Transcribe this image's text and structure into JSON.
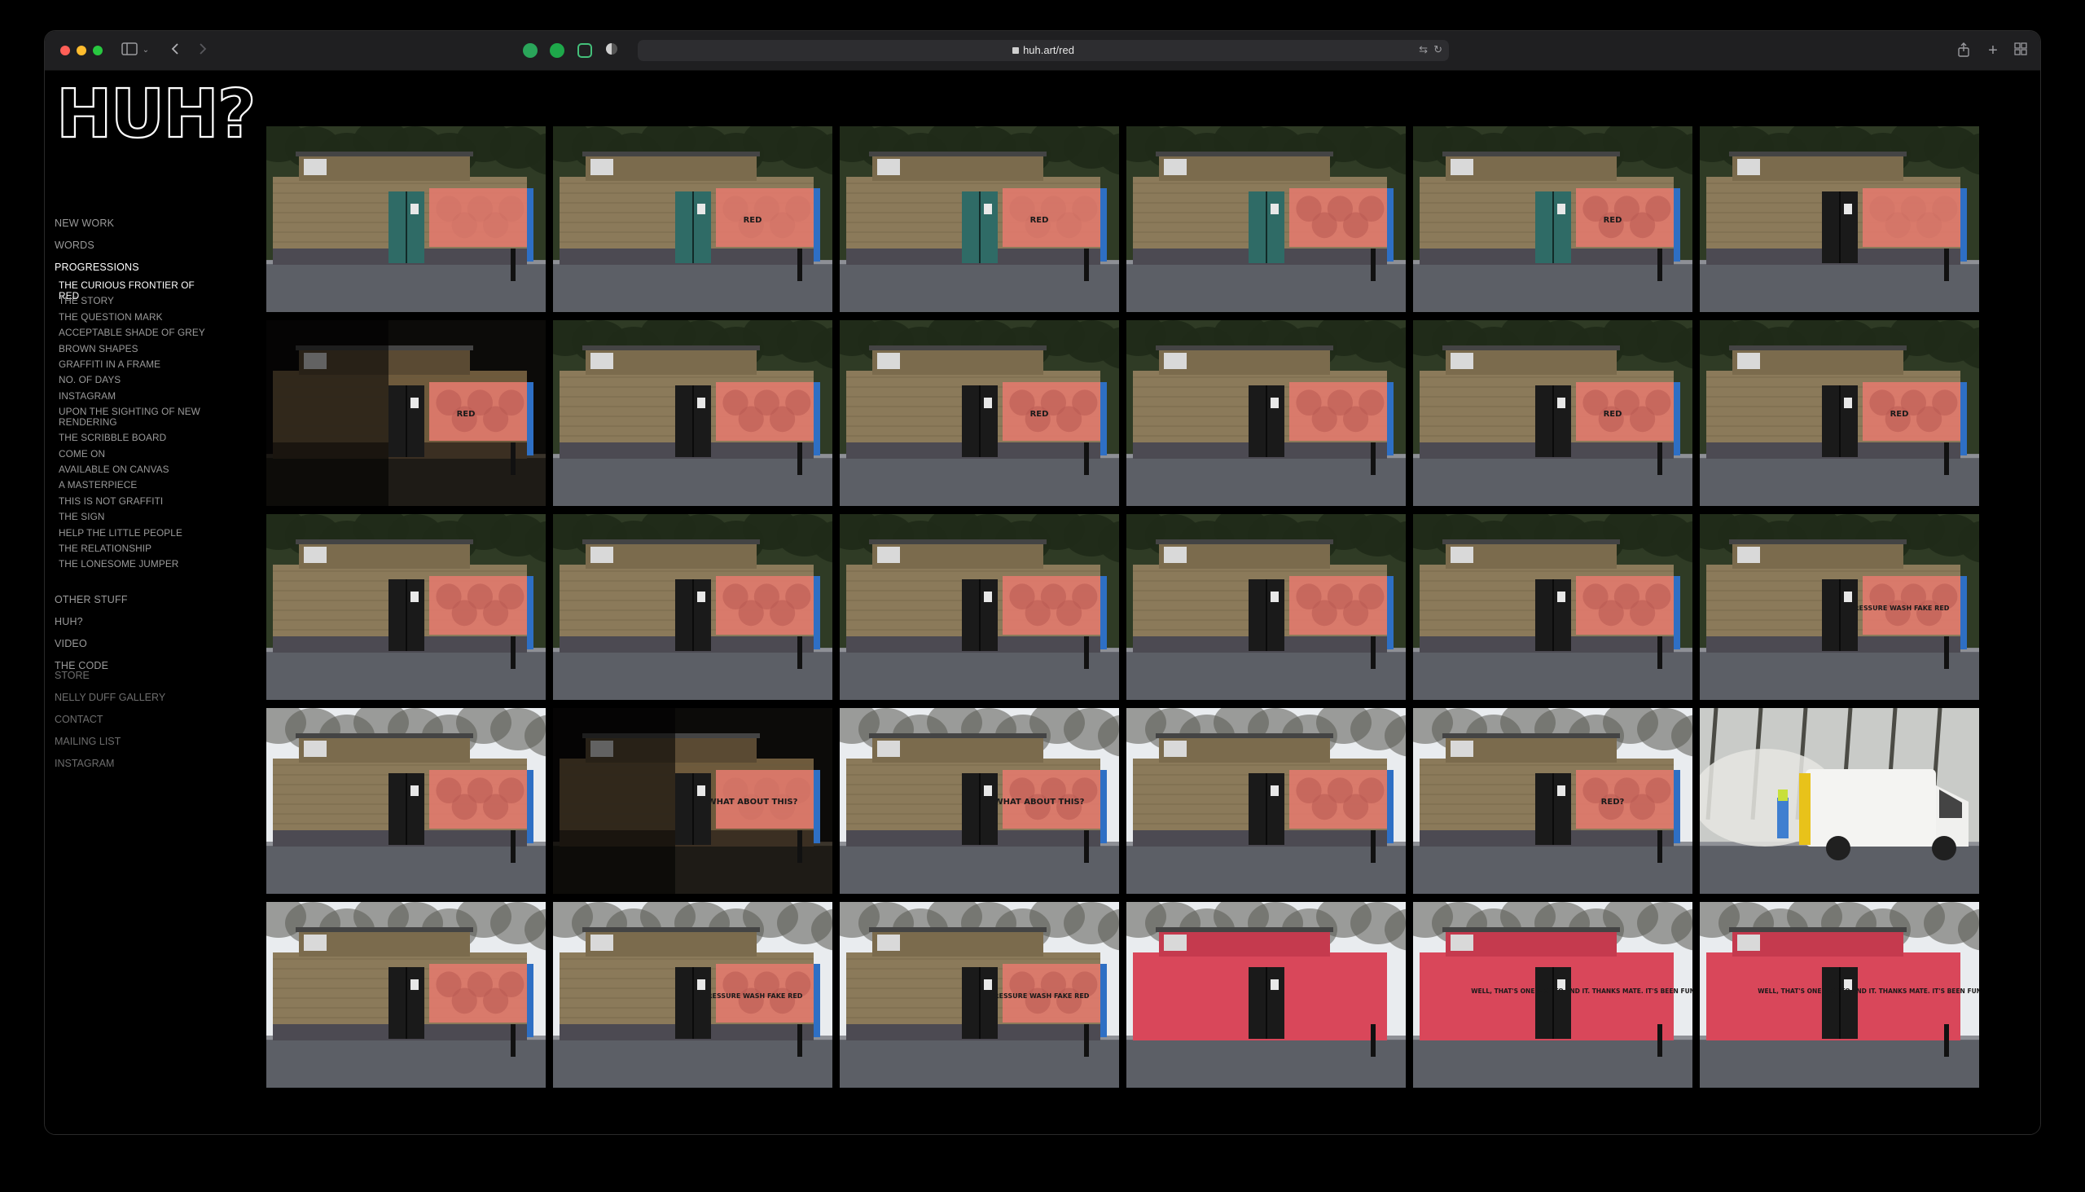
{
  "browser": {
    "url": "huh.art/red"
  },
  "site": {
    "logo_text": "HUH?",
    "nav": {
      "main_top": [
        {
          "label": "NEW WORK",
          "active": false
        },
        {
          "label": "WORDS",
          "active": false
        },
        {
          "label": "PROGRESSIONS",
          "active": true
        }
      ],
      "sub": [
        {
          "label": "THE CURIOUS FRONTIER OF RED",
          "active": true
        },
        {
          "label": "THE STORY",
          "active": false
        },
        {
          "label": "THE QUESTION MARK",
          "active": false
        },
        {
          "label": "ACCEPTABLE SHADE OF GREY",
          "active": false
        },
        {
          "label": "BROWN SHAPES",
          "active": false
        },
        {
          "label": "GRAFFITI IN A FRAME",
          "active": false
        },
        {
          "label": "NO. OF DAYS",
          "active": false
        },
        {
          "label": "INSTAGRAM",
          "active": false
        },
        {
          "label": "UPON THE SIGHTING OF NEW RENDERING",
          "active": false
        },
        {
          "label": "THE SCRIBBLE BOARD",
          "active": false
        },
        {
          "label": "COME ON",
          "active": false
        },
        {
          "label": "AVAILABLE ON CANVAS",
          "active": false
        },
        {
          "label": "A MASTERPIECE",
          "active": false
        },
        {
          "label": "THIS IS NOT GRAFFITI",
          "active": false
        },
        {
          "label": "THE SIGN",
          "active": false
        },
        {
          "label": "HELP THE LITTLE PEOPLE",
          "active": false
        },
        {
          "label": "THE RELATIONSHIP",
          "active": false
        },
        {
          "label": "THE LONESOME JUMPER",
          "active": false
        }
      ],
      "main_bottom": [
        "OTHER STUFF",
        "HUH?",
        "VIDEO",
        "THE CODE"
      ],
      "external": [
        "STORE",
        "NELLY DUFF GALLERY",
        "CONTACT",
        "MAILING LIST",
        "INSTAGRAM"
      ]
    }
  },
  "gallery": {
    "colors": {
      "red_paint": "#e07a6c",
      "red_painted_wall": "#d9475a",
      "brick": "#8b7a5a",
      "door_teal": "#2f6b66",
      "door_black": "#1a1a1a",
      "sky_white": "#e9ecef",
      "road": "#5c5f66"
    },
    "rows": [
      [
        {
          "style": "brick",
          "door": "teal",
          "patch": "full",
          "text": ""
        },
        {
          "style": "brick",
          "door": "teal",
          "patch": "full",
          "text": "RED"
        },
        {
          "style": "brick",
          "door": "teal",
          "patch": "full",
          "text": "RED"
        },
        {
          "style": "brick",
          "door": "teal",
          "patch": "blobs",
          "text": ""
        },
        {
          "style": "brick",
          "door": "teal",
          "patch": "blobs",
          "text": "RED"
        },
        {
          "style": "brick",
          "door": "black",
          "patch": "full",
          "text": ""
        }
      ],
      [
        {
          "style": "night",
          "door": "black",
          "patch": "blobs",
          "text": "RED"
        },
        {
          "style": "brick",
          "door": "black",
          "patch": "blobs",
          "text": ""
        },
        {
          "style": "brick",
          "door": "black",
          "patch": "blobs",
          "text": "RED"
        },
        {
          "style": "brick",
          "door": "black",
          "patch": "blobs",
          "text": ""
        },
        {
          "style": "brick",
          "door": "black",
          "patch": "blobs",
          "text": "RED"
        },
        {
          "style": "brick",
          "door": "black",
          "patch": "blobs",
          "text": "RED"
        }
      ],
      [
        {
          "style": "brick",
          "door": "black",
          "patch": "blobs",
          "text": ""
        },
        {
          "style": "brick",
          "door": "black",
          "patch": "blobs",
          "text": ""
        },
        {
          "style": "brick",
          "door": "black",
          "patch": "blobs",
          "text": ""
        },
        {
          "style": "brick",
          "door": "black",
          "patch": "blobs",
          "text": ""
        },
        {
          "style": "brick",
          "door": "black",
          "patch": "blobs",
          "text": ""
        },
        {
          "style": "brick",
          "door": "black",
          "patch": "blobs",
          "text": "PRESSURE WASH FAKE RED"
        }
      ],
      [
        {
          "style": "brick",
          "door": "black",
          "patch": "blobs",
          "text": ""
        },
        {
          "style": "night",
          "door": "black",
          "patch": "full",
          "text": "WHAT ABOUT THIS?"
        },
        {
          "style": "brick",
          "door": "black",
          "patch": "blobs",
          "text": "WHAT ABOUT THIS?"
        },
        {
          "style": "brick",
          "door": "black",
          "patch": "blobs",
          "text": ""
        },
        {
          "style": "brick",
          "door": "black",
          "patch": "blobs",
          "text": "RED?"
        },
        {
          "style": "van",
          "door": "none",
          "patch": "none",
          "text": ""
        }
      ],
      [
        {
          "style": "brick",
          "door": "black",
          "patch": "blobs",
          "text": ""
        },
        {
          "style": "brick",
          "door": "black",
          "patch": "blobs",
          "text": "PRESSURE WASH FAKE RED"
        },
        {
          "style": "brick",
          "door": "black",
          "patch": "blobs",
          "text": "PRESSURE WASH FAKE RED"
        },
        {
          "style": "redwall",
          "door": "black",
          "patch": "none",
          "text": ""
        },
        {
          "style": "redwall",
          "door": "black",
          "patch": "none",
          "text": "WELL, THAT'S ONE WAY TO END IT. THANKS MATE. IT'S BEEN FUN."
        },
        {
          "style": "redwall",
          "door": "black",
          "patch": "none",
          "text": "WELL, THAT'S ONE WAY TO END IT. THANKS MATE. IT'S BEEN FUN."
        }
      ]
    ]
  }
}
